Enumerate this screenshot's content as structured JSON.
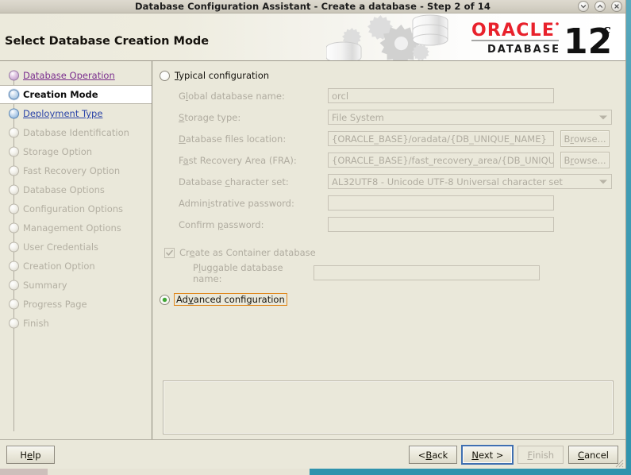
{
  "window": {
    "title": "Database Configuration Assistant - Create a database - Step 2 of 14",
    "controls": [
      {
        "name": "minimize-button",
        "glyph": "minimize"
      },
      {
        "name": "maximize-button",
        "glyph": "maximize"
      },
      {
        "name": "close-button",
        "glyph": "close"
      }
    ]
  },
  "banner": {
    "title": "Select Database Creation Mode",
    "brand_line1": "ORACLE",
    "brand_line2": "DATABASE",
    "version_number": "12",
    "version_suffix": "c"
  },
  "sidebar": {
    "items": [
      {
        "label": "Database Operation",
        "state": "done"
      },
      {
        "label": "Creation Mode",
        "state": "current"
      },
      {
        "label": "Deployment Type",
        "state": "next"
      },
      {
        "label": "Database Identification",
        "state": "future"
      },
      {
        "label": "Storage Option",
        "state": "future"
      },
      {
        "label": "Fast Recovery Option",
        "state": "future"
      },
      {
        "label": "Database Options",
        "state": "future"
      },
      {
        "label": "Configuration Options",
        "state": "future"
      },
      {
        "label": "Management Options",
        "state": "future"
      },
      {
        "label": "User Credentials",
        "state": "future"
      },
      {
        "label": "Creation Option",
        "state": "future"
      },
      {
        "label": "Summary",
        "state": "future"
      },
      {
        "label": "Progress Page",
        "state": "future"
      },
      {
        "label": "Finish",
        "state": "future"
      }
    ]
  },
  "main": {
    "typical_radio": {
      "label_pre": "",
      "label_mnemonic": "T",
      "label_post": "ypical configuration",
      "selected": false
    },
    "advanced_radio": {
      "label_pre": "Ad",
      "label_mnemonic": "v",
      "label_post": "anced configuration",
      "selected": true,
      "focused": true
    },
    "fields": [
      {
        "label_pre": "G",
        "label_mnemonic": "l",
        "label_post": "obal database name:",
        "type": "text",
        "value": "orcl",
        "width": "w-long",
        "browse": false
      },
      {
        "label_pre": "",
        "label_mnemonic": "S",
        "label_post": "torage type:",
        "type": "combo",
        "value": "File System",
        "width": "w-wide",
        "browse": false
      },
      {
        "label_pre": "",
        "label_mnemonic": "D",
        "label_post": "atabase files location:",
        "type": "text",
        "value": "{ORACLE_BASE}/oradata/{DB_UNIQUE_NAME}",
        "width": "w-mid",
        "browse": true,
        "browse_pre": "B",
        "browse_mnemonic": "r",
        "browse_post": "owse..."
      },
      {
        "label_pre": "F",
        "label_mnemonic": "a",
        "label_post": "st Recovery Area (FRA):",
        "type": "text",
        "value": "{ORACLE_BASE}/fast_recovery_area/{DB_UNIQU",
        "width": "w-mid",
        "browse": true,
        "browse_pre": "B",
        "browse_mnemonic": "r",
        "browse_post": "owse..."
      },
      {
        "label_pre": "Database ",
        "label_mnemonic": "c",
        "label_post": "haracter set:",
        "type": "combo",
        "value": "AL32UTF8 - Unicode UTF-8 Universal character set",
        "width": "w-wide",
        "browse": false
      },
      {
        "label_pre": "Admin",
        "label_mnemonic": "i",
        "label_post": "strative password:",
        "type": "text",
        "value": "",
        "width": "w-long",
        "browse": false
      },
      {
        "label_pre": "Confirm ",
        "label_mnemonic": "p",
        "label_post": "assword:",
        "type": "text",
        "value": "",
        "width": "w-long",
        "browse": false
      }
    ],
    "container_checkbox": {
      "label_pre": "Cr",
      "label_mnemonic": "e",
      "label_post": "ate as Container database",
      "checked": true,
      "disabled": true
    },
    "pdb_field": {
      "label_pre": "P",
      "label_mnemonic": "l",
      "label_post": "uggable database name:",
      "value": "",
      "width": "w-long"
    },
    "message_panel": {
      "text": ""
    }
  },
  "footer": {
    "help": {
      "pre": "H",
      "mnemonic": "e",
      "post": "lp",
      "disabled": false,
      "focused": false
    },
    "back": {
      "pre": "< ",
      "mnemonic": "B",
      "post": "ack",
      "disabled": false,
      "focused": false
    },
    "next": {
      "pre": "",
      "mnemonic": "N",
      "post": "ext >",
      "disabled": false,
      "focused": true
    },
    "finish": {
      "pre": "",
      "mnemonic": "F",
      "post": "inish",
      "disabled": true,
      "focused": false
    },
    "cancel": {
      "pre": "",
      "mnemonic": "C",
      "post": "ancel",
      "disabled": false,
      "focused": false
    }
  },
  "colors": {
    "window_bg": "#eae8da",
    "oracle_red": "#e8212b",
    "accent_focus": "#e08a21",
    "radio_green": "#3ea832",
    "link_visited": "#7b2f8e",
    "link_next": "#2b44a8",
    "desktop": "#2f93ad"
  }
}
